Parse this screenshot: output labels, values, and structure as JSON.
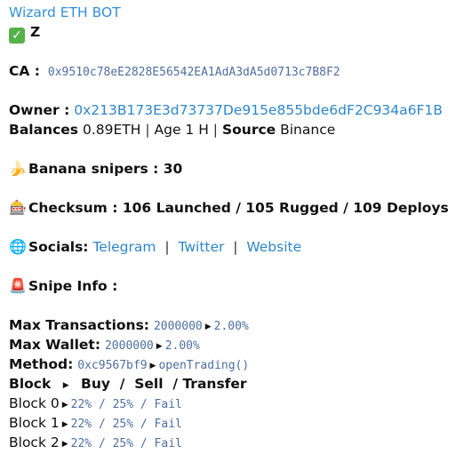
{
  "bot_name": "Wizard ETH BOT",
  "token_name": "Z",
  "ca": {
    "label": "CA :",
    "address": "0x9510c78eE2828E56542EA1AdA3dA5d0713c7B8F2"
  },
  "owner": {
    "label": "Owner :",
    "address": "0x213B173E3d73737De915e855bde6dF2C934a6F1B"
  },
  "balances": {
    "label": "Balances",
    "value": "0.89ETH",
    "age": "Age 1 H",
    "source_label": "Source",
    "source_value": "Binance"
  },
  "banana": {
    "icon": "banana-icon",
    "label": "Banana snipers : 30"
  },
  "checksum": {
    "icon": "slot-machine-icon",
    "label": "Checksum : 106 Launched / 105 Rugged / 109 Deploys"
  },
  "socials": {
    "icon": "globe-icon",
    "label": "Socials:",
    "links": [
      "Telegram",
      "Twitter",
      "Website"
    ]
  },
  "snipe": {
    "icon": "siren-icon",
    "label": "Snipe Info :"
  },
  "max_tx": {
    "label": "Max Transactions:",
    "value": "2000000",
    "pct": "2.00%"
  },
  "max_wallet": {
    "label": "Max Wallet:",
    "value": "2000000",
    "pct": "2.00%"
  },
  "method": {
    "label": "Method:",
    "value": "0xc9567bf9",
    "fn": "openTrading()"
  },
  "block_header": {
    "block": "Block",
    "buy": "Buy",
    "sell": "Sell",
    "transfer": "Transfer"
  },
  "blocks": [
    {
      "label": "Block 0",
      "value": "22% / 25% / Fail"
    },
    {
      "label": "Block 1",
      "value": "22% / 25% / Fail"
    },
    {
      "label": "Block 2",
      "value": "22% / 25% / Fail"
    }
  ],
  "colors": {
    "link": "#2f86c9",
    "mono": "#4f6fa0",
    "check": "#55b14a"
  }
}
